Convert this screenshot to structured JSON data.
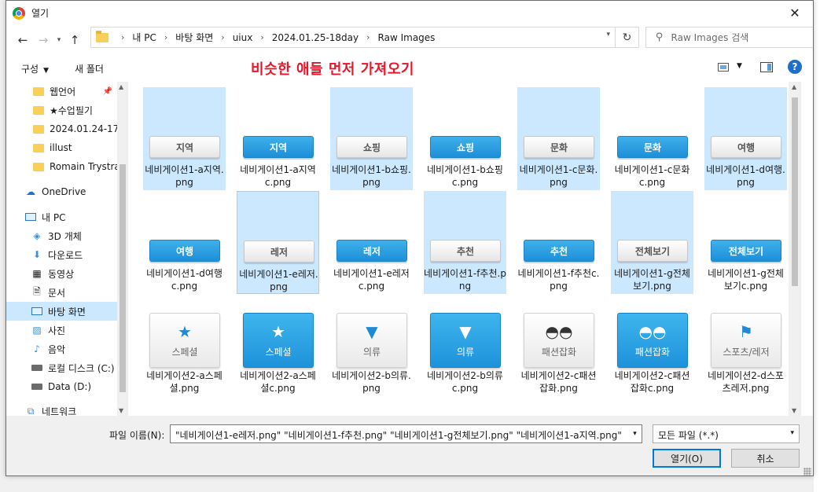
{
  "window": {
    "title": "열기",
    "close_label": "✕"
  },
  "address": {
    "crumbs": [
      "내 PC",
      "바탕 화면",
      "uiux",
      "2024.01.25-18day",
      "Raw Images"
    ],
    "search_placeholder": "Raw Images 검색"
  },
  "toolbar": {
    "organize_label": "구성",
    "new_folder_label": "새 폴더",
    "annotation": "비슷한 애들 먼저 가져오기"
  },
  "nav": {
    "items": [
      {
        "label": "웹언어",
        "icon": "folder-icon",
        "pinned": true
      },
      {
        "label": "★수업필기",
        "icon": "folder-icon"
      },
      {
        "label": "2024.01.24-17c",
        "icon": "folder-icon"
      },
      {
        "label": "illust",
        "icon": "folder-icon"
      },
      {
        "label": "Romain Trystran",
        "icon": "folder-icon"
      },
      {
        "label": "OneDrive",
        "icon": "cloud-icon"
      },
      {
        "label": "내 PC",
        "icon": "pc-icon"
      },
      {
        "label": "3D 개체",
        "icon": "cube-icon"
      },
      {
        "label": "다운로드",
        "icon": "download-icon"
      },
      {
        "label": "동영상",
        "icon": "video-icon"
      },
      {
        "label": "문서",
        "icon": "document-icon"
      },
      {
        "label": "바탕 화면",
        "icon": "desktop-icon",
        "selected": true
      },
      {
        "label": "사진",
        "icon": "picture-icon"
      },
      {
        "label": "음악",
        "icon": "music-icon"
      },
      {
        "label": "로컬 디스크 (C:)",
        "icon": "drive-icon"
      },
      {
        "label": "Data (D:)",
        "icon": "drive-icon"
      },
      {
        "label": "네트워크",
        "icon": "network-icon"
      }
    ]
  },
  "files": {
    "row1": [
      {
        "name": "네비게이션1-a지역.png",
        "text": "지역",
        "style": "plain",
        "selected": true
      },
      {
        "name": "네비게이션1-a지역c.png",
        "text": "지역",
        "style": "blue",
        "selected": false
      },
      {
        "name": "네비게이션1-b쇼핑.png",
        "text": "쇼핑",
        "style": "plain",
        "selected": true
      },
      {
        "name": "네비게이션1-b쇼핑c.png",
        "text": "쇼핑",
        "style": "blue",
        "selected": false
      },
      {
        "name": "네비게이션1-c문화.png",
        "text": "문화",
        "style": "plain",
        "selected": true
      },
      {
        "name": "네비게이션1-c문화c.png",
        "text": "문화",
        "style": "blue",
        "selected": false
      },
      {
        "name": "네비게이션1-d여행.png",
        "text": "여행",
        "style": "plain",
        "selected": true
      }
    ],
    "row2": [
      {
        "name": "네비게이션1-d여행c.png",
        "text": "여행",
        "style": "blue",
        "selected": false
      },
      {
        "name": "네비게이션1-e레저.png",
        "text": "레저",
        "style": "plain",
        "selected": true,
        "focused": true
      },
      {
        "name": "네비게이션1-e레저c.png",
        "text": "레저",
        "style": "blue",
        "selected": false
      },
      {
        "name": "네비게이션1-f추천.png",
        "text": "추천",
        "style": "plain",
        "selected": true
      },
      {
        "name": "네비게이션1-f추천c.png",
        "text": "추천",
        "style": "blue",
        "selected": false
      },
      {
        "name": "네비게이션1-g전체보기.png",
        "text": "전체보기",
        "style": "plain",
        "selected": true
      },
      {
        "name": "네비게이션1-g전체보기c.png",
        "text": "전체보기",
        "style": "blue",
        "selected": false
      }
    ],
    "row3": [
      {
        "name": "네비게이션2-a스페셜.png",
        "text": "스페셜",
        "symbol": "★",
        "style": "plain"
      },
      {
        "name": "네비게이션2-a스페셜c.png",
        "text": "스페셜",
        "symbol": "★",
        "style": "blue"
      },
      {
        "name": "네비게이션2-b의류.png",
        "text": "의류",
        "symbol": "👕",
        "style": "plain"
      },
      {
        "name": "네비게이션2-b의류c.png",
        "text": "의류",
        "symbol": "👕",
        "style": "blue"
      },
      {
        "name": "네비게이션2-c패션잡화.png",
        "text": "패션잡화",
        "symbol": "👓",
        "style": "plain"
      },
      {
        "name": "네비게이션2-c패션잡화c.png",
        "text": "패션잡화",
        "symbol": "👓",
        "style": "blue"
      },
      {
        "name": "네비게이션2-d스포츠레저.png",
        "text": "스포츠/레저",
        "symbol": "⛳",
        "style": "plain"
      }
    ]
  },
  "footer": {
    "filename_label": "파일 이름(N):",
    "filename_value": "\"네비게이션1-e레저.png\" \"네비게이션1-f추천.png\" \"네비게이션1-g전체보기.png\" \"네비게이션1-a지역.png\"",
    "filetype_value": "모든 파일 (*.*)",
    "open_label": "열기(O)",
    "cancel_label": "취소"
  },
  "colors": {
    "selection": "#cce8ff",
    "accent": "#0078d7",
    "annotation": "#e8162a",
    "tile_blue": "#1e92da"
  }
}
